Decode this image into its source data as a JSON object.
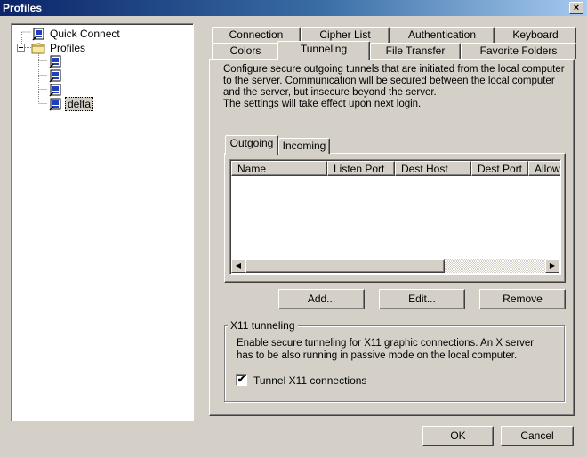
{
  "window": {
    "title": "Profiles",
    "close_glyph": "×"
  },
  "tree": {
    "items": [
      {
        "label": "Quick Connect",
        "icon": "computer-profile-icon"
      },
      {
        "label": "Profiles",
        "icon": "folder-icon"
      },
      {
        "label": "",
        "icon": "computer-profile-icon"
      },
      {
        "label": "",
        "icon": "computer-profile-icon"
      },
      {
        "label": "",
        "icon": "computer-profile-icon"
      },
      {
        "label": "delta",
        "icon": "computer-profile-icon",
        "selected": true
      }
    ]
  },
  "tabs": {
    "row_top": [
      "Connection",
      "Cipher List",
      "Authentication",
      "Keyboard"
    ],
    "row_bottom": [
      "Colors",
      "Tunneling",
      "File Transfer",
      "Favorite Folders"
    ],
    "active": "Tunneling"
  },
  "tunneling": {
    "description": [
      "Configure secure outgoing tunnels that are initiated from the local computer",
      "to the server. Communication will be secured between the local computer",
      "and the server, but insecure beyond the server.",
      "The settings will take effect upon next login."
    ],
    "subtabs": [
      "Outgoing",
      "Incoming"
    ],
    "active_subtab": "Outgoing",
    "columns": [
      "Name",
      "Listen Port",
      "Dest Host",
      "Dest Port",
      "Allow"
    ],
    "rows": [],
    "buttons": {
      "add": "Add...",
      "edit": "Edit...",
      "remove": "Remove"
    }
  },
  "x11": {
    "title": "X11 tunneling",
    "description": [
      "Enable secure tunneling for X11 graphic connections. An X server",
      "has to be also running in passive mode on the local computer."
    ],
    "checkbox_label": "Tunnel X11 connections",
    "checked": true,
    "check_glyph": "✔"
  },
  "dialog_buttons": {
    "ok": "OK",
    "cancel": "Cancel"
  },
  "scroll": {
    "left_glyph": "◀",
    "right_glyph": "▶"
  }
}
